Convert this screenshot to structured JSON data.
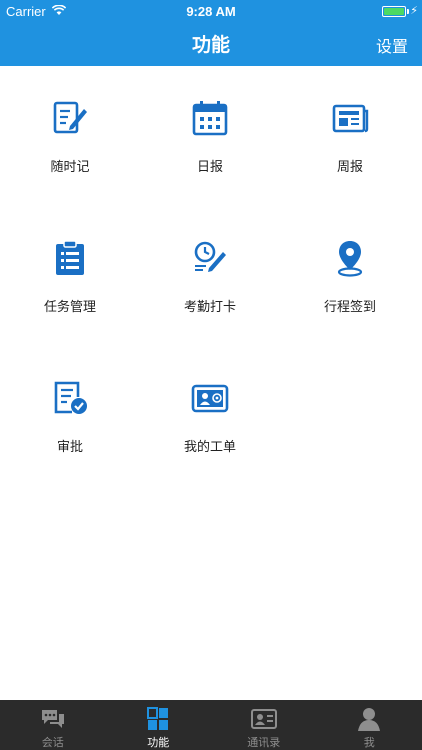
{
  "status_bar": {
    "carrier": "Carrier",
    "time": "9:28 AM",
    "battery_level": 1.0
  },
  "nav": {
    "title": "功能",
    "right_button": "设置"
  },
  "features": [
    {
      "label": "随时记",
      "icon": "note-pencil-icon"
    },
    {
      "label": "日报",
      "icon": "calendar-icon"
    },
    {
      "label": "周报",
      "icon": "newspaper-icon"
    },
    {
      "label": "任务管理",
      "icon": "clipboard-list-icon"
    },
    {
      "label": "考勤打卡",
      "icon": "clock-pen-icon"
    },
    {
      "label": "行程签到",
      "icon": "location-pin-icon"
    },
    {
      "label": "审批",
      "icon": "document-check-icon"
    },
    {
      "label": "我的工单",
      "icon": "id-card-icon"
    }
  ],
  "tabbar": {
    "tabs": [
      {
        "label": "会话",
        "icon": "chat-bubbles-icon",
        "active": false
      },
      {
        "label": "功能",
        "icon": "grid-icon",
        "active": true
      },
      {
        "label": "通讯录",
        "icon": "contact-card-icon",
        "active": false
      },
      {
        "label": "我",
        "icon": "person-icon",
        "active": false
      }
    ]
  },
  "colors": {
    "header": "#1f92e0",
    "icon": "#1a6fc4",
    "tabbar": "#2b2b2b",
    "tab_active": "#1f92e0"
  }
}
